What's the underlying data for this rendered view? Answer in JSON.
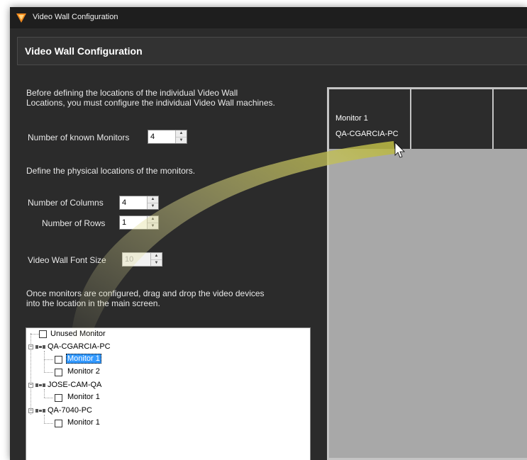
{
  "window": {
    "title": "Video Wall Configuration"
  },
  "header": {
    "title": "Video Wall Configuration"
  },
  "left": {
    "intro_line1": "Before defining the locations of the individual Video Wall",
    "intro_line2": "Locations, you must configure the individual Video Wall machines.",
    "known_monitors_label": "Number of known Monitors",
    "known_monitors_value": "4",
    "physical_label": "Define the physical locations of the monitors.",
    "columns_label": "Number of Columns",
    "columns_value": "4",
    "rows_label": "Number of Rows",
    "rows_value": "1",
    "font_size_label": "Video Wall Font Size",
    "font_size_value": "10",
    "drag_line1": "Once monitors are configured, drag and drop the video devices",
    "drag_line2": "into the location in the main screen."
  },
  "tree": {
    "unused": "Unused Monitor",
    "machines": [
      {
        "name": "QA-CGARCIA-PC",
        "monitors": [
          "Monitor 1",
          "Monitor 2"
        ]
      },
      {
        "name": "JOSE-CAM-QA",
        "monitors": [
          "Monitor 1"
        ]
      },
      {
        "name": "QA-7040-PC",
        "monitors": [
          "Monitor 1"
        ]
      }
    ]
  },
  "wall": {
    "cell1_monitor": "Monitor 1",
    "cell1_machine": "QA-CGARCIA-PC"
  },
  "colors": {
    "background": "#2b2b2b",
    "selection": "#3399ff",
    "drag_arrow": "#e6e08a"
  }
}
